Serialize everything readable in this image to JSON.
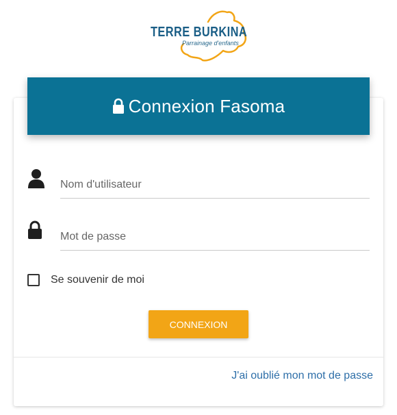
{
  "logo": {
    "title": "TERRE BURKINA",
    "subtitle": "Parrainage d'enfants",
    "color": "#f2a516",
    "text_color": "#1a5e86"
  },
  "header": {
    "title": "Connexion Fasoma",
    "icon": "lock-icon",
    "background": "#0b7295"
  },
  "form": {
    "username": {
      "icon": "user-icon",
      "placeholder": "Nom d'utilisateur",
      "value": ""
    },
    "password": {
      "icon": "lock-icon",
      "placeholder": "Mot de passe",
      "value": ""
    },
    "remember_label": "Se souvenir de moi",
    "remember_checked": false,
    "submit_label": "CONNEXION",
    "submit_color": "#f2a516"
  },
  "footer": {
    "forgot_link": "J'ai oublié mon mot de passe",
    "link_color": "#2d6ea8"
  }
}
